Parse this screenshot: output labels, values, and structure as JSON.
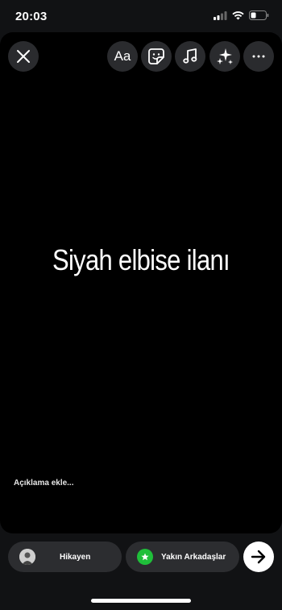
{
  "status_bar": {
    "time": "20:03"
  },
  "toolbar": {
    "close_icon": "close-icon",
    "text_tool_label": "Aa",
    "sticker_icon": "sticker-icon",
    "music_icon": "music-note-icon",
    "effects_icon": "sparkles-icon",
    "more_icon": "more-icon"
  },
  "story": {
    "text": "Siyah elbise  ilanı"
  },
  "caption": {
    "placeholder": "Açıklama ekle..."
  },
  "share": {
    "story_label": "Hikayen",
    "close_friends_label": "Yakın Arkadaşlar",
    "close_friends_color": "#1fbf3a"
  }
}
